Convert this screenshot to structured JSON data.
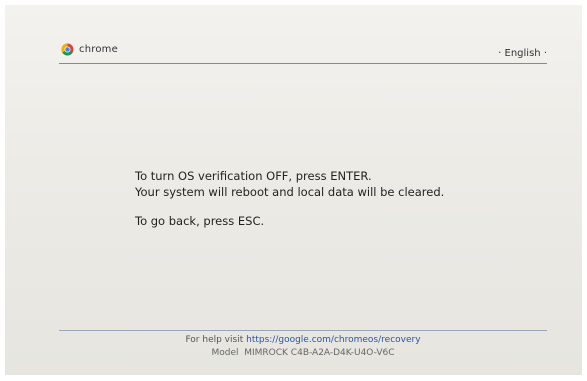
{
  "header": {
    "logo_text": "chrome",
    "language": "· English ·"
  },
  "messages": {
    "line1": "To turn OS verification OFF, press ENTER.",
    "line2": "Your system will reboot and local data will be cleared.",
    "line3": "To go back, press ESC."
  },
  "footer": {
    "help_prefix": "For help visit",
    "help_url": "https://google.com/chromeos/recovery",
    "model_label": "Model",
    "model_value": "MIMROCK C4B-A2A-D4K-U4O-V6C"
  },
  "colors": {
    "link": "#2a55a8",
    "rule": "#7d8ab0"
  }
}
